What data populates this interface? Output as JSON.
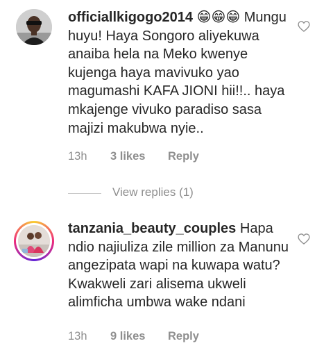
{
  "comments": [
    {
      "username": "officiallkigogo2014",
      "text": "😁😁😁 Mungu huyu! Haya Songoro aliyekuwa anaiba hela na Meko kwenye kujenga haya mavivuko yao magumashi KAFA JIONI hii!!.. haya mkajenge vivuko paradiso sasa majizi makubwa nyie..",
      "time": "13h",
      "likes": "3 likes",
      "reply_label": "Reply",
      "avatar_icon": "profile-photo"
    },
    {
      "username": "tanzania_beauty_couples",
      "text": "Hapa ndio najiuliza zile million za Manunu angezipata wapi na kuwapa watu?  Kwakweli zari alisema ukweli alimficha umbwa wake ndani",
      "time": "13h",
      "likes": "9 likes",
      "reply_label": "Reply",
      "avatar_icon": "profile-photo-with-story-ring"
    }
  ],
  "view_replies": "View replies (1)",
  "colors": {
    "text": "#262626",
    "meta": "#8e8e8e",
    "story_ring": [
      "#f9ce34",
      "#ee2a7b",
      "#6228d7"
    ]
  }
}
